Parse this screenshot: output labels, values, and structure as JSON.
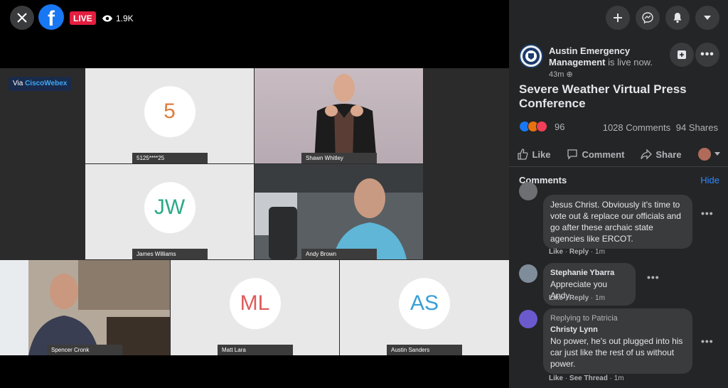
{
  "player": {
    "live_label": "LIVE",
    "viewer_count": "1.9K"
  },
  "webex": {
    "via": "Via",
    "brand": "CiscoWebex"
  },
  "tiles": [
    {
      "initials": "5",
      "name": "5125****25",
      "color": "#e07b39"
    },
    {
      "initials": "",
      "name": "Shawn Whitley"
    },
    {
      "initials": "JW",
      "name": "James Williams",
      "color": "#2aaa8a"
    },
    {
      "initials": "",
      "name": "Andy Brown"
    },
    {
      "initials": "",
      "name": "Spencer Cronk"
    },
    {
      "initials": "ML",
      "name": "Matt Lara",
      "color": "#e05a5a"
    },
    {
      "initials": "AS",
      "name": "Austin Sanders",
      "color": "#3a9fd6"
    }
  ],
  "post": {
    "author": "Austin Emergency Management",
    "status": "is live now.",
    "time": "43m",
    "title": "Severe Weather Virtual Press Conference",
    "reaction_count": "96",
    "comments_count": "1028 Comments",
    "shares_count": "94 Shares",
    "actions": {
      "like": "Like",
      "comment": "Comment",
      "share": "Share"
    }
  },
  "comments_section": {
    "title": "Comments",
    "hide": "Hide",
    "items": [
      {
        "author": "",
        "reply_to": "",
        "text": "Jesus Christ. Obviously it's time to vote out & replace our officials and go after these archaic state agencies like ERCOT.",
        "like": "Like",
        "action": "Reply",
        "time": "1m"
      },
      {
        "author": "Stephanie Ybarra",
        "reply_to": "",
        "text": "Appreciate you Andy",
        "like": "Like",
        "action": "Reply",
        "time": "1m"
      },
      {
        "author": "Christy Lynn",
        "reply_to": "Replying to Patricia",
        "text": "No power, he's out plugged into his car just like the rest of us without power.",
        "like": "Like",
        "action": "See Thread",
        "time": "1m"
      }
    ]
  },
  "colors": {
    "accent": "#1877f2",
    "live": "#e41e3f",
    "sidebar_bg": "#242526",
    "bubble_bg": "#3a3b3c",
    "link": "#2d88ff"
  }
}
